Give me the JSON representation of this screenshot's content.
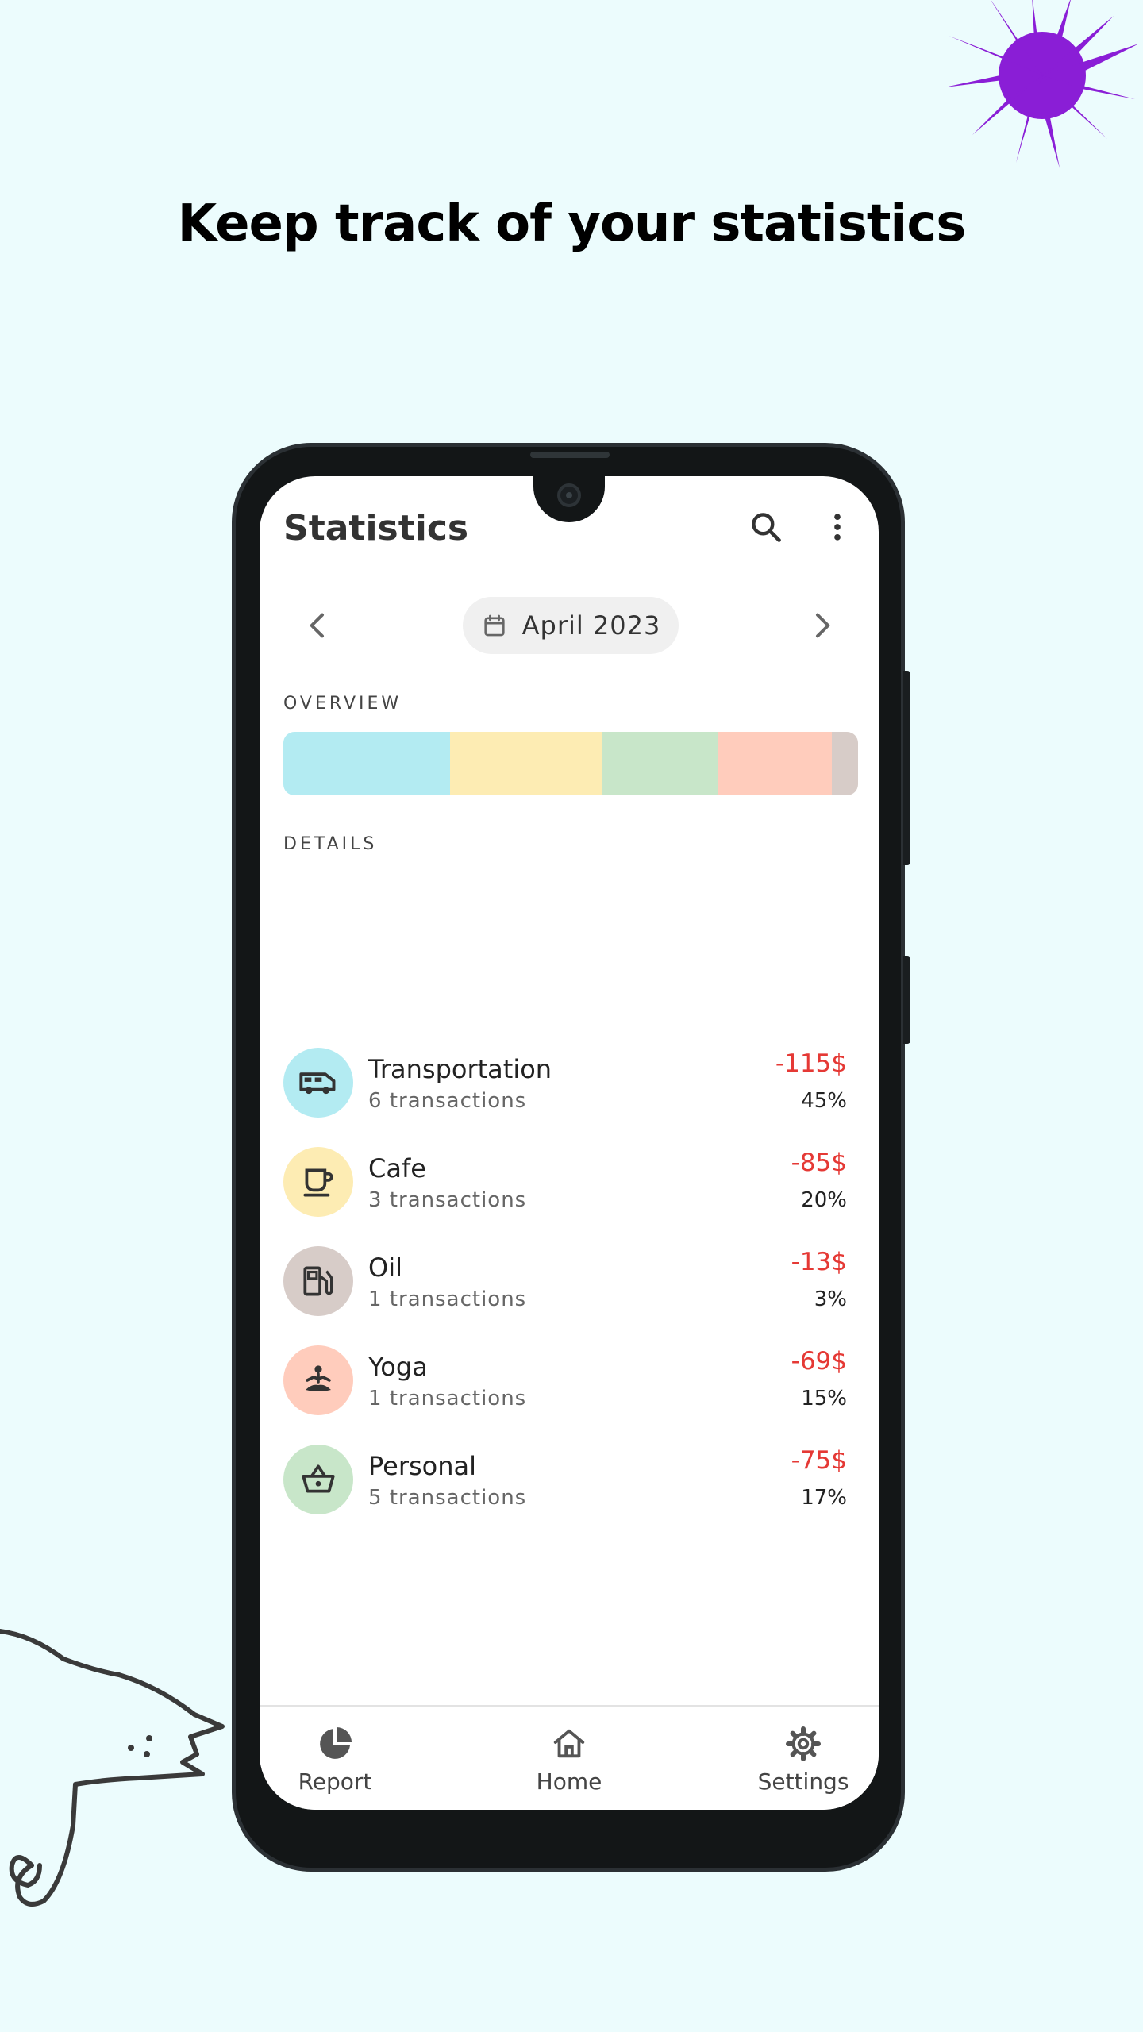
{
  "promo": {
    "headline": "Keep track of your statistics"
  },
  "app": {
    "title": "Statistics",
    "month_label": "April 2023",
    "overview_label": "OVERVIEW",
    "details_label": "DETAILS",
    "overview_segments": [
      {
        "color": "#b3ebf2",
        "share": 0.29
      },
      {
        "color": "#fdecb3",
        "share": 0.265
      },
      {
        "color": "#c8e6c9",
        "share": 0.2
      },
      {
        "color": "#ffccbc",
        "share": 0.2
      },
      {
        "color": "#d7ccc8",
        "share": 0.045
      }
    ],
    "categories": [
      {
        "name": "Transportation",
        "transactions": "6 transactions",
        "amount": "-115$",
        "percent": "45%",
        "color": "#b3ebf2",
        "icon": "van-icon"
      },
      {
        "name": "Cafe",
        "transactions": "3 transactions",
        "amount": "-85$",
        "percent": "20%",
        "color": "#fdecb3",
        "icon": "coffee-cup-icon"
      },
      {
        "name": "Oil",
        "transactions": "1 transactions",
        "amount": "-13$",
        "percent": "3%",
        "color": "#d7ccc8",
        "icon": "fuel-pump-icon"
      },
      {
        "name": "Yoga",
        "transactions": "1 transactions",
        "amount": "-69$",
        "percent": "15%",
        "color": "#ffccbc",
        "icon": "meditation-icon"
      },
      {
        "name": "Personal",
        "transactions": "5 transactions",
        "amount": "-75$",
        "percent": "17%",
        "color": "#c8e6c9",
        "icon": "basket-icon"
      }
    ],
    "bottom_nav": [
      {
        "label": "Report",
        "icon": "pie-chart-icon"
      },
      {
        "label": "Home",
        "icon": "home-icon"
      },
      {
        "label": "Settings",
        "icon": "gear-icon"
      }
    ],
    "colors": {
      "accent_negative": "#e53935",
      "background": "#ecfcfd",
      "decoration": "#8a1ed6"
    }
  }
}
